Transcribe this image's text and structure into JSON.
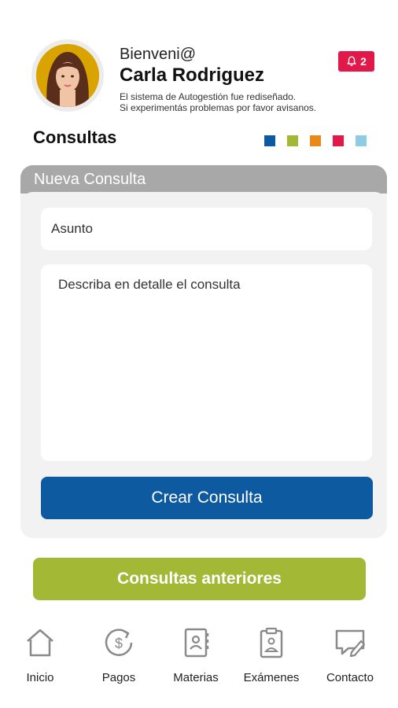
{
  "header": {
    "welcome": "Bienveni@",
    "user_name": "Carla Rodriguez",
    "notice_line1": "El sistema de  Autogestión fue  rediseñado.",
    "notice_line2": "Si experimentás problemas por favor avisanos.",
    "notifications_count": "2",
    "notifications_icon": "bell-icon"
  },
  "section": {
    "title": "Consultas",
    "color_dots": [
      "#0d5aa1",
      "#a3b936",
      "#e8891c",
      "#e0194a",
      "#8fcbe3"
    ]
  },
  "form": {
    "header": "Nueva Consulta",
    "subject_placeholder": "Asunto",
    "detail_placeholder": "Describa en detalle el consulta",
    "submit_label": "Crear Consulta"
  },
  "previous_button": "Consultas anteriores",
  "nav": {
    "items": [
      {
        "label": "Inicio",
        "icon": "home-icon"
      },
      {
        "label": "Pagos",
        "icon": "payment-icon"
      },
      {
        "label": "Materias",
        "icon": "notebook-icon"
      },
      {
        "label": "Exámenes",
        "icon": "clipboard-icon"
      },
      {
        "label": "Contacto",
        "icon": "chat-edit-icon"
      }
    ]
  },
  "colors": {
    "accent_blue": "#0d5aa1",
    "accent_green": "#a3b936",
    "badge_red": "#e0194a",
    "panel_header": "#a8a8a8"
  }
}
